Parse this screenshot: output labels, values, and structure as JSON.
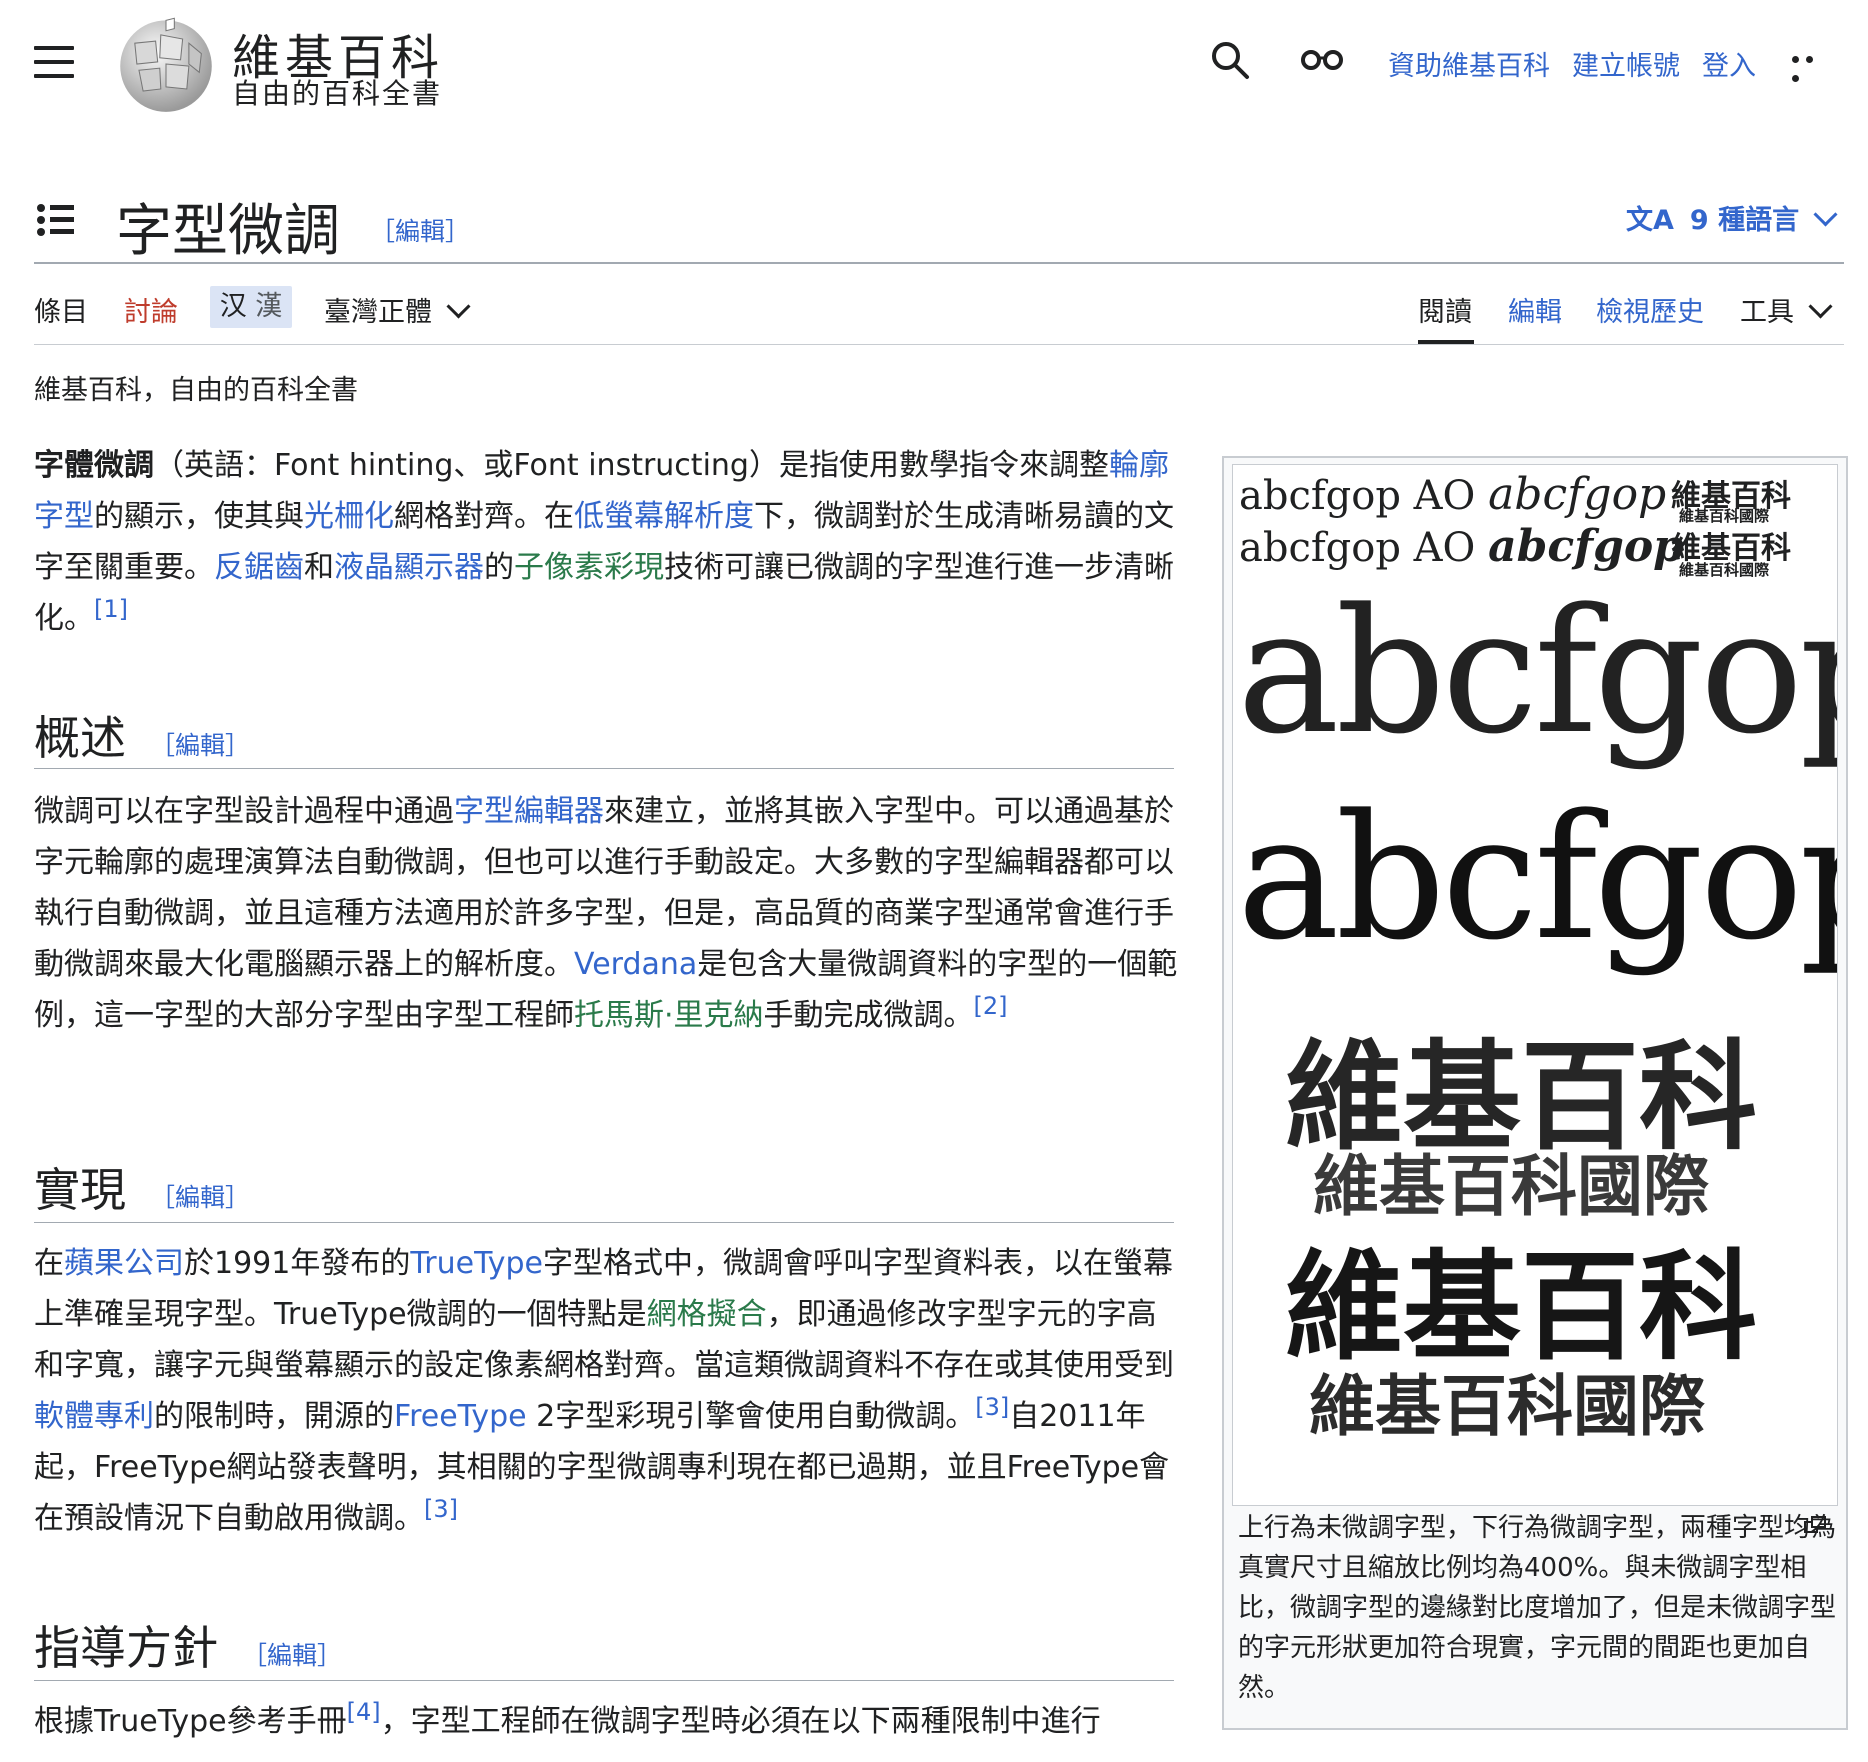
{
  "header": {
    "wordmark": "維基百科",
    "tagline": "自由的百科全書",
    "links": [
      "資助維基百科",
      "建立帳號",
      "登入"
    ]
  },
  "page": {
    "title": "字型微調",
    "edit_label": "［編輯］",
    "languages": "9 種語言",
    "lang_icon": "文A"
  },
  "tabs": {
    "article": "條目",
    "talk": "討論",
    "variant_simplified": "汉",
    "variant_traditional": "漢",
    "variant_select": "臺灣正體",
    "read": "閱讀",
    "edit": "編輯",
    "history": "檢視歷史",
    "tools": "工具"
  },
  "site_sub": "維基百科，自由的百科全書",
  "intro": {
    "bold": "字體微調",
    "t1": "（英語：Font hinting、或Font instructing）是指使用數學指令來調整",
    "l1": "輪廓字型",
    "t2": "的顯示，使其與",
    "l2": "光柵化",
    "t3": "網格對齊。在",
    "l3": "低螢幕解析度",
    "t4": "下，微調對於生成清晰易讀的文字至關重要。",
    "l4": "反鋸齒",
    "t5": "和",
    "l5": "液晶顯示器",
    "t6": "的",
    "l6": "子像素彩現",
    "t7": "技術可讓已微調的字型進行進一步清晰化。",
    "ref": "[1]"
  },
  "sections": {
    "overview": {
      "heading": "概述",
      "t1": "微調可以在字型設計過程中通過",
      "l1": "字型編輯器",
      "t2": "來建立，並將其嵌入字型中。可以通過基於字元輪廓的處理演算法自動微調，但也可以進行手動設定。大多數的字型編輯器都可以執行自動微調，並且這種方法適用於許多字型，但是，高品質的商業字型通常會進行手動微調來最大化電腦顯示器上的解析度。",
      "l2": "Verdana",
      "t3": "是包含大量微調資料的字型的一個範例，這一字型的大部分字型由字型工程師",
      "l3": "托馬斯·里克納",
      "t4": "手動完成微調。",
      "ref": "[2]"
    },
    "implementation": {
      "heading": "實現",
      "t1": "在",
      "l1": "蘋果公司",
      "t2": "於1991年發布的",
      "l2": "TrueType",
      "t3": "字型格式中，微調會呼叫字型資料表，以在螢幕上準確呈現字型。TrueType微調的一個特點是",
      "l3": "網格擬合",
      "t4": "，即通過修改字型字元的字高和字寬，讓字元與螢幕顯示的設定像素網格對齊。當這類微調資料不存在或其使用受到",
      "l4": "軟體專利",
      "t5": "的限制時，開源的",
      "l5": "FreeType",
      "t6": " 2字型彩現引擎會使用自動微調。",
      "ref1": "[3]",
      "t7": "自2011年起，FreeType網站發表聲明，其相關的字型微調專利現在都已過期，並且FreeType會在預設情況下自動啟用微調。",
      "ref2": "[3]"
    },
    "guidelines": {
      "heading": "指導方針",
      "t1": "根據TrueType參考手冊",
      "ref": "[4]",
      "t2": "，字型工程師在微調字型時必須在以下兩種限制中進行"
    }
  },
  "infobox": {
    "sample_latin": "abcfgop AO",
    "sample_italic": "abcfgop",
    "sample_cjk": "維基百科",
    "sample_cjk_small": "維基百科國際",
    "big_latin": "abcfgop",
    "big_cjk": "維基百科",
    "big_cjk_2": "維基百科國際",
    "caption": "上行為未微調字型，下行為微調字型，兩種字型均為真實尺寸且縮放比例均為400%。與未微調字型相比，微調字型的邊緣對比度增加了，但是未微調字型的字元形狀更加符合現實，字元間的間距也更加自然。"
  }
}
